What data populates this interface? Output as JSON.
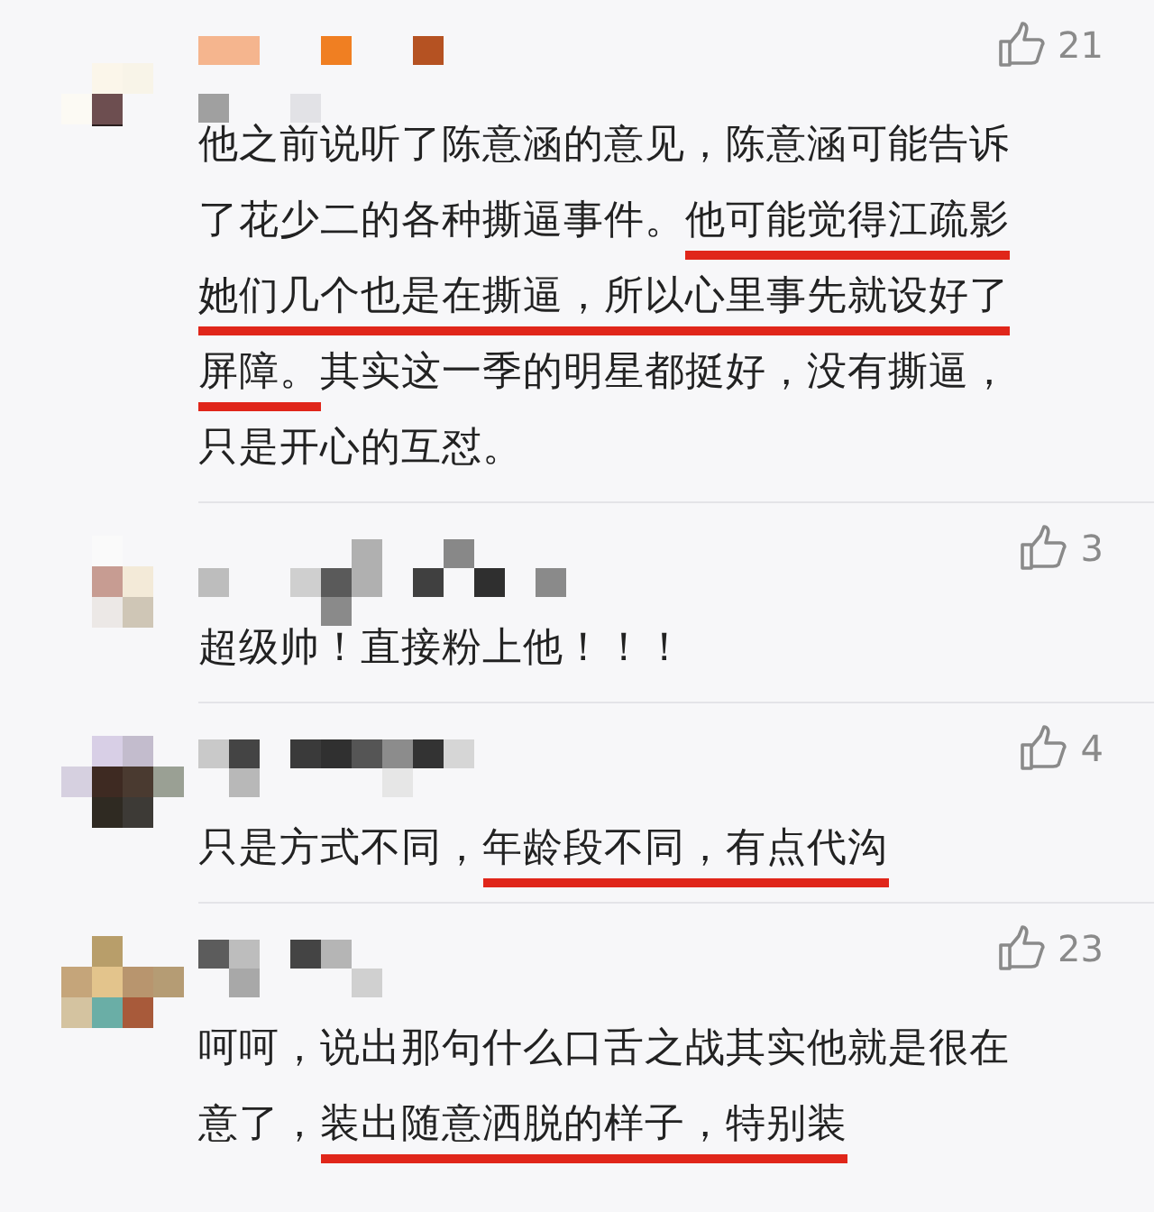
{
  "comments": [
    {
      "likes": "21",
      "text": [
        {
          "text": "他之前说听了陈意涵的意见，陈意涵可能告诉了花少二的各种撕逼事件。",
          "underlined": false
        },
        {
          "text": "他可能觉得江疏影她们几个也是在撕逼，所以心里事先就设好了屏障。",
          "underlined": true
        },
        {
          "text": "其实这一季的明星都挺好，没有撕逼，只是开心的互怼。",
          "underlined": false
        }
      ]
    },
    {
      "likes": "3",
      "text": [
        {
          "text": "超级帅！直接粉上他！！！",
          "underlined": false
        }
      ]
    },
    {
      "likes": "4",
      "text": [
        {
          "text": "只是方式不同，",
          "underlined": false
        },
        {
          "text": "年龄段不同，有点代沟",
          "underlined": true
        }
      ]
    },
    {
      "likes": "23",
      "text": [
        {
          "text": "呵呵，说出那句什么口舌之战其实他就是很在意了，",
          "underlined": false
        },
        {
          "text": "装出随意洒脱的样子，特别装",
          "underlined": true
        }
      ]
    }
  ]
}
